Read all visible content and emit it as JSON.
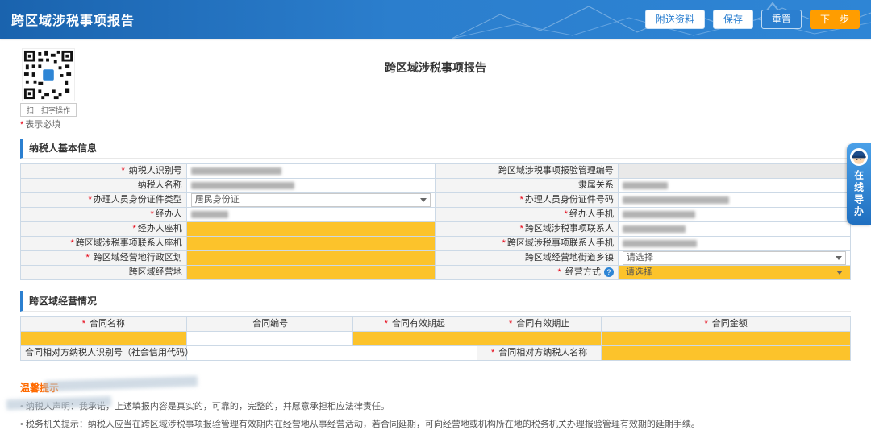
{
  "colors": {
    "header_blue": "#2b7ecd",
    "highlight_yellow": "#fcc32b",
    "required_red": "#e60012",
    "next_orange": "#ff9d00"
  },
  "header": {
    "title": "跨区域涉税事项报告",
    "buttons": {
      "attach": "附送资料",
      "save": "保存",
      "reset": "重置",
      "next": "下一步"
    }
  },
  "page": {
    "title": "跨区域涉税事项报告",
    "qr_caption": "扫一扫字操作",
    "required_star": "*",
    "required_note": "表示必填"
  },
  "basic": {
    "title": "纳税人基本信息",
    "rows": [
      {
        "left_star": "*",
        "left_label": " 纳税人识别号",
        "right_star": "",
        "right_label": "跨区域涉税事项报验管理编号"
      },
      {
        "left_star": "",
        "left_label": "纳税人名称",
        "right_star": "",
        "right_label": "隶属关系"
      },
      {
        "left_star": "*",
        "left_label": "办理人员身份证件类型",
        "right_star": "*",
        "right_label": "办理人员身份证件号码"
      },
      {
        "left_star": "*",
        "left_label": "经办人",
        "right_star": "*",
        "right_label": "经办人手机"
      },
      {
        "left_star": "*",
        "left_label": "经办人座机",
        "right_star": "*",
        "right_label": "跨区域涉税事项联系人"
      },
      {
        "left_star": "*",
        "left_label": "跨区域涉税事项联系人座机",
        "right_star": "*",
        "right_label": "跨区域涉税事项联系人手机"
      },
      {
        "left_star": "*",
        "left_label": " 跨区域经营地行政区划",
        "right_star": "",
        "right_label": "跨区域经营地街道乡镇"
      },
      {
        "left_star": "",
        "left_label": "跨区域经营地",
        "right_star": "*",
        "right_label": " 经营方式"
      }
    ],
    "id_type_value": "居民身份证",
    "street_placeholder": "请选择",
    "mode_placeholder": "请选择",
    "help_glyph": "?"
  },
  "contract": {
    "title": "跨区域经营情况",
    "headers": [
      {
        "star": "*",
        "text": " 合同名称"
      },
      {
        "star": "",
        "text": "合同编号"
      },
      {
        "star": "*",
        "text": " 合同有效期起"
      },
      {
        "star": "*",
        "text": " 合同有效期止"
      },
      {
        "star": "*",
        "text": " 合同金额"
      }
    ],
    "party_id_label": "合同相对方纳税人识别号（社会信用代码）",
    "party_name_star": "*",
    "party_name_label": " 合同相对方纳税人名称"
  },
  "tips": {
    "title": "温馨提示",
    "items": [
      "纳税人声明：我承诺，上述填报内容是真实的，可靠的，完整的，并愿意承担相应法律责任。",
      "税务机关提示：纳税人应当在跨区域涉税事项报验管理有效期内在经营地从事经营活动，若合同延期，可向经营地或机构所在地的税务机关办理报验管理有效期的延期手续。"
    ]
  },
  "floater": {
    "label": "在线导办"
  }
}
